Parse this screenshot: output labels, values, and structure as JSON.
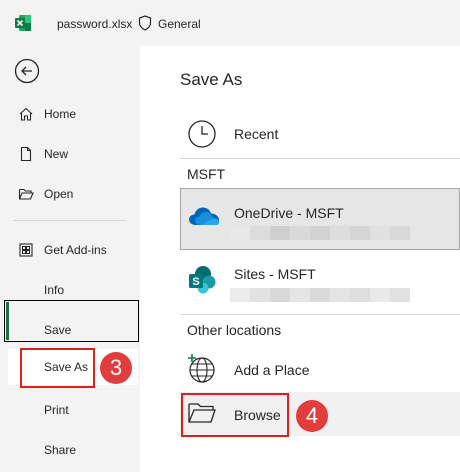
{
  "titlebar": {
    "filename": "password.xlsx",
    "sensitivity": "General",
    "app_icon": "excel-icon"
  },
  "nav": {
    "items": [
      {
        "label": "Home",
        "icon": "home-icon"
      },
      {
        "label": "New",
        "icon": "new-file-icon"
      },
      {
        "label": "Open",
        "icon": "folder-open-icon"
      },
      {
        "label": "Get Add-ins",
        "icon": "addins-icon"
      },
      {
        "label": "Info"
      },
      {
        "label": "Save"
      },
      {
        "label": "Save As",
        "selected": true
      },
      {
        "label": "Print"
      },
      {
        "label": "Share"
      }
    ]
  },
  "annotations": {
    "step3": "3",
    "step4": "4",
    "color": "#e01e1e"
  },
  "main": {
    "title": "Save As",
    "recent_label": "Recent",
    "section_msft": "MSFT",
    "onedrive_label": "OneDrive - MSFT",
    "sites_label": "Sites - MSFT",
    "section_other": "Other locations",
    "add_place_label": "Add a Place",
    "browse_label": "Browse"
  },
  "colors": {
    "accent": "#1e7145",
    "panel": "#f3f3f3",
    "highlight": "#e6e6e6"
  }
}
